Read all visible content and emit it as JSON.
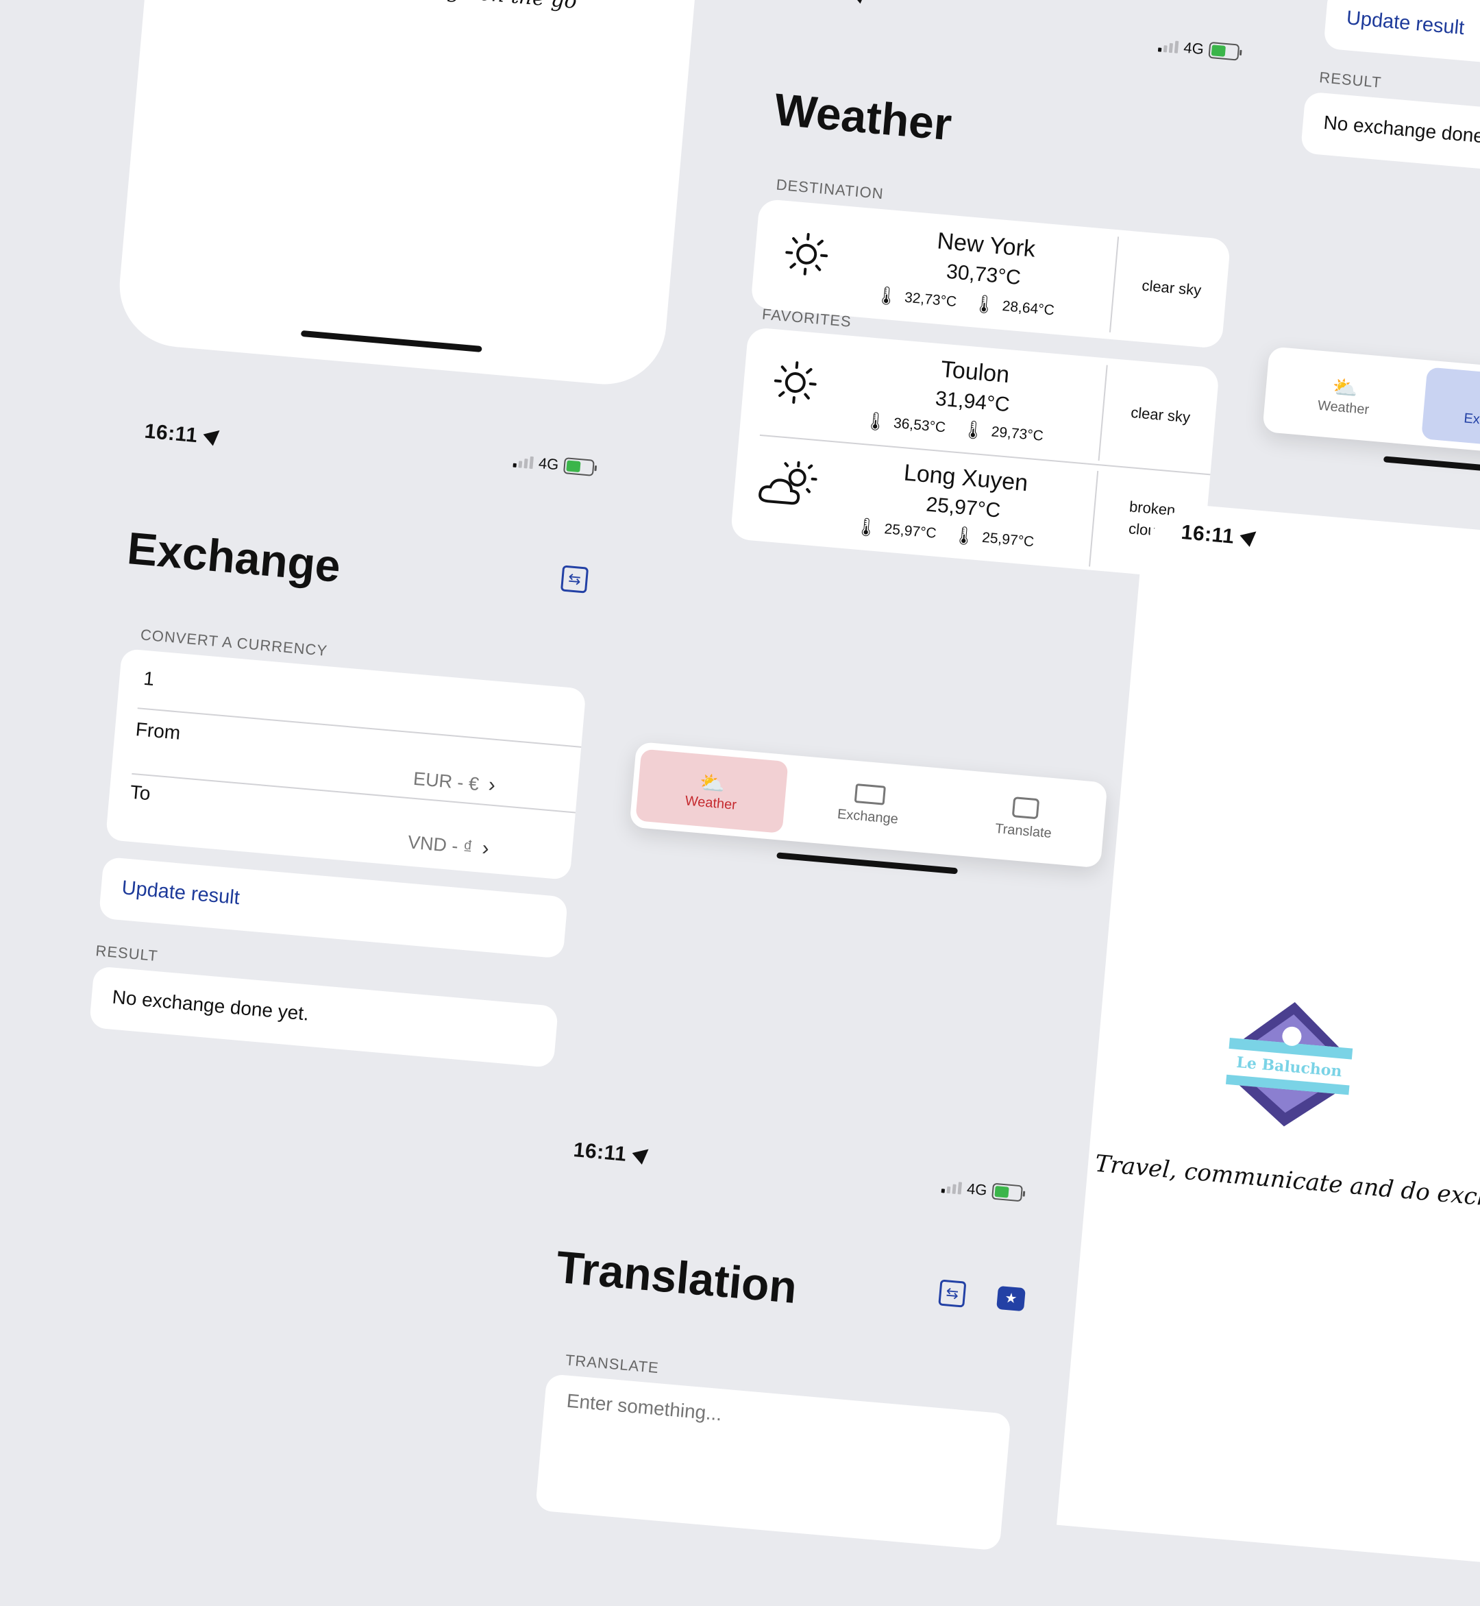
{
  "status_bar": {
    "time": "16:11",
    "network": "4G"
  },
  "splash": {
    "tagline_top": "nge on the go",
    "logo_text": "Le Baluchon",
    "tagline": "Travel, communicate and do exchange on the go"
  },
  "weather": {
    "title": "Weather",
    "destination_header": "DESTINATION",
    "favorites_header": "FAVORITES",
    "destination": {
      "city": "New York",
      "temp": "30,73°C",
      "max": "32,73°C",
      "min": "28,64°C",
      "desc": "clear sky",
      "icon": "sun-icon"
    },
    "favorites": [
      {
        "city": "Toulon",
        "temp": "31,94°C",
        "max": "36,53°C",
        "min": "29,73°C",
        "desc": "clear sky",
        "icon": "sun-icon"
      },
      {
        "city": "Long Xuyen",
        "temp": "25,97°C",
        "max": "25,97°C",
        "min": "25,97°C",
        "desc_line1": "broken",
        "desc_line2": "clouds",
        "icon": "cloud-sun-icon"
      }
    ]
  },
  "exchange": {
    "title": "Exchange",
    "convert_header": "CONVERT A CURRENCY",
    "amount": "1",
    "from_label": "From",
    "from_value": "EUR - €",
    "to_label": "To",
    "to_value": "VND - ₫",
    "update_button": "Update result",
    "result_header": "RESULT",
    "result_text": "No exchange done yet."
  },
  "exchange_right": {
    "update_button": "Update result",
    "result_header": "RESULT",
    "result_text": "No exchange done yet."
  },
  "translation": {
    "title": "Translation",
    "translate_header": "TRANSLATE",
    "input_placeholder": "Enter something..."
  },
  "tabs": {
    "weather": "Weather",
    "exchange": "Exchange",
    "translate": "Translate"
  },
  "colors": {
    "background": "#e9eaee",
    "link_blue": "#1d3a9a",
    "weather_tab_bg": "#f2d0d3",
    "weather_tab_fg": "#c52a2f",
    "exchange_tab_bg": "#c9d3f2",
    "exchange_tab_fg": "#2341a5",
    "battery": "#3bb54a"
  }
}
